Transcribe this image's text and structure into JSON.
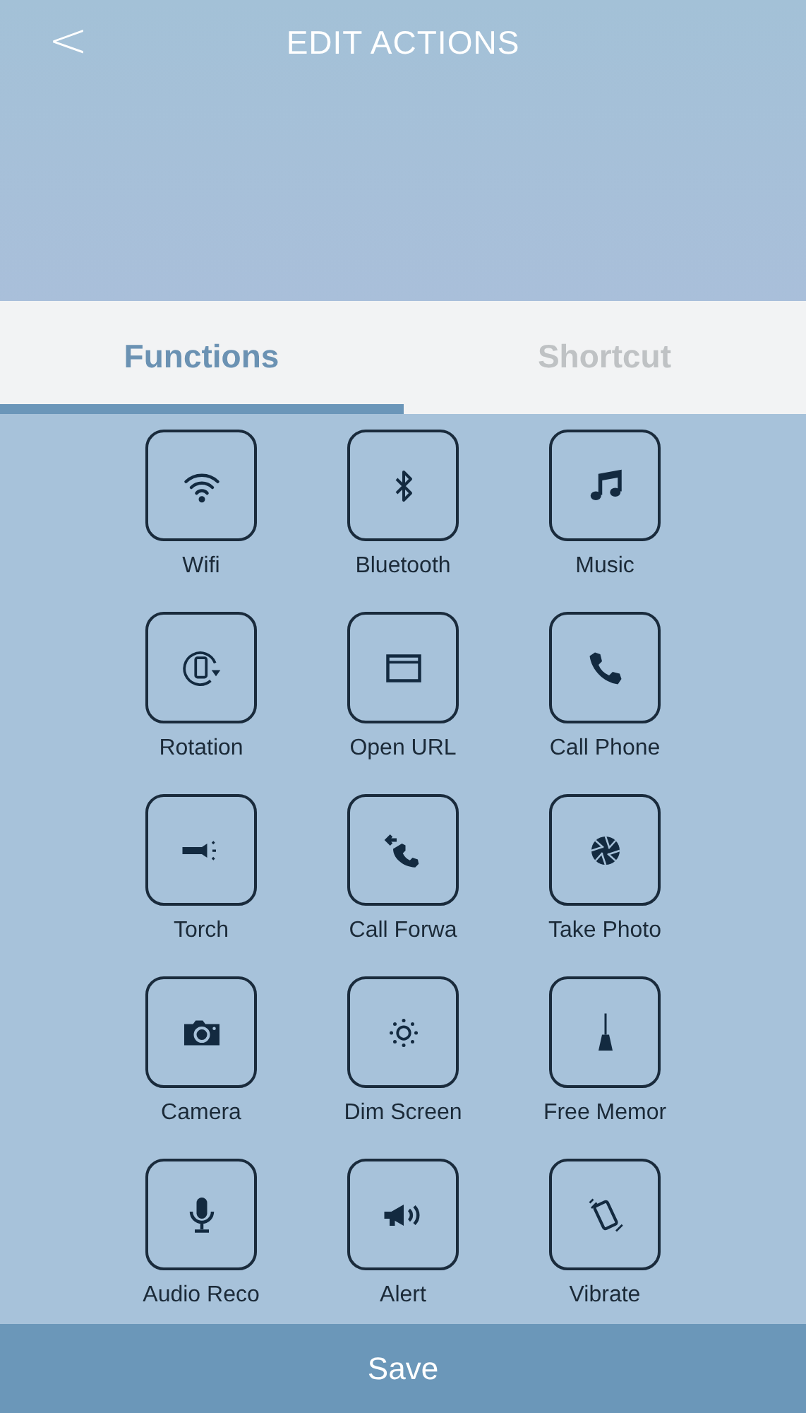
{
  "header": {
    "back": "<",
    "title": "EDIT ACTIONS"
  },
  "tabs": [
    {
      "label": "Functions",
      "selected": true
    },
    {
      "label": "Shortcut",
      "selected": false
    }
  ],
  "actions": [
    {
      "label": "Wifi"
    },
    {
      "label": "Bluetooth"
    },
    {
      "label": "Music"
    },
    {
      "label": "Rotation"
    },
    {
      "label": "Open URL"
    },
    {
      "label": "Call Phone"
    },
    {
      "label": "Torch"
    },
    {
      "label": "Call Forwa"
    },
    {
      "label": "Take Photo"
    },
    {
      "label": "Camera"
    },
    {
      "label": "Dim Screen"
    },
    {
      "label": "Free Memor"
    },
    {
      "label": "Audio Reco"
    },
    {
      "label": "Alert"
    },
    {
      "label": "Vibrate"
    }
  ],
  "save_button": "Save"
}
